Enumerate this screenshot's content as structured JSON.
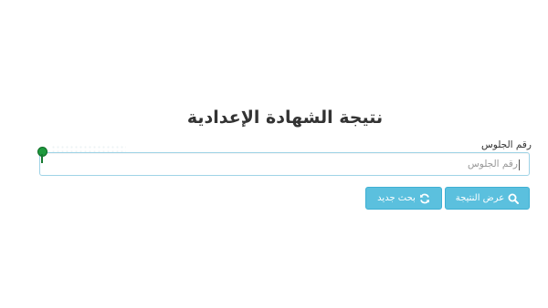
{
  "page": {
    "title": "نتيجة الشهادة الإعدادية"
  },
  "form": {
    "seat_label": "رقم الجلوس",
    "seat_placeholder": "رقم الجلوس",
    "seat_value": ""
  },
  "actions": {
    "show_result_label": "عرض النتيجة",
    "show_result_icon": "search-icon",
    "new_search_label": "بحث جديد",
    "new_search_icon": "refresh-icon"
  },
  "colors": {
    "button_bg": "#5bc0de",
    "input_border": "#9fd3e6",
    "marker": "#1f9a3e"
  }
}
